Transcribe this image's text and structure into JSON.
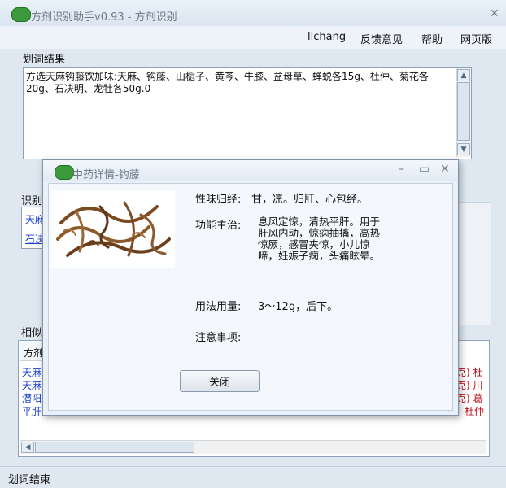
{
  "window": {
    "title": "方剂识别助手v0.93 - 方剂识别",
    "close_glyph": "✕"
  },
  "menu": {
    "items": [
      "lichang",
      "反馈意见",
      "帮助",
      "网页版"
    ]
  },
  "segment": {
    "group_label": "划词结果",
    "text": "方选天麻钩藤饮加味:天麻、钩藤、山栀子、黄芩、牛膝、益母草、蝉蜕各15g、杜仲、菊花各20g、石决明、龙牡各50g.0"
  },
  "recognition": {
    "group_label": "识别",
    "links": [
      "天麻",
      "石决"
    ]
  },
  "similar": {
    "group_label": "相似",
    "header_cell": "方剂",
    "rows_left": [
      "天麻",
      "天麻",
      "潜阳",
      "平肝"
    ],
    "rows_right": [
      "克) 杜",
      "克) 川",
      "克) 葛",
      "杜仲"
    ]
  },
  "dialog": {
    "title": "中药详情-钩藤",
    "minimize_glyph": "–",
    "maximize_glyph": "▭",
    "close_glyph": "✕",
    "nature_label": "性味归经:",
    "nature_value": "甘，凉。归肝、心包经。",
    "function_label": "功能主治:",
    "function_lines": [
      "息风定惊，清热平肝。用于",
      "肝风内动，惊痫抽搐，高热",
      "惊厥，感冒夹惊，小儿惊",
      "啼，妊娠子痫，头痛眩晕。"
    ],
    "usage_label": "用法用量:",
    "usage_value": "3～12g，后下。",
    "caution_label": "注意事项:",
    "caution_value": "",
    "close_button": "关闭",
    "image_icon": "herb-photo"
  },
  "status": {
    "text": "划词结束"
  },
  "colors": {
    "link_blue": "#1a3fd0",
    "link_red": "#c0101a",
    "logo_green": "#3c9a3c"
  }
}
